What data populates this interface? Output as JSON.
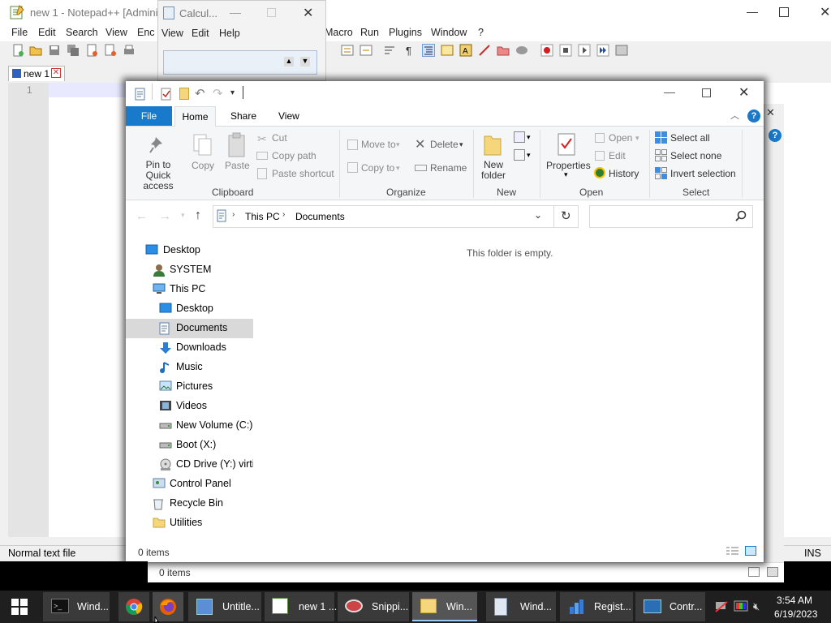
{
  "notepad": {
    "title": "new 1 - Notepad++ [Adminis",
    "menu": [
      "File",
      "Edit",
      "Search",
      "View",
      "Enc",
      "Macro",
      "Run",
      "Plugins",
      "Window",
      "?"
    ],
    "tab_label": "new 1",
    "line_number": "1",
    "status_left": "Normal text file",
    "status_right": "INS"
  },
  "calculator": {
    "title": "Calcul...",
    "menu": [
      "View",
      "Edit",
      "Help"
    ]
  },
  "explorer": {
    "tabs": [
      "File",
      "Home",
      "Share",
      "View"
    ],
    "ribbon": {
      "clipboard": {
        "pin": "Pin to Quick access",
        "copy": "Copy",
        "paste": "Paste",
        "cut": "Cut",
        "copy_path": "Copy path",
        "paste_shortcut": "Paste shortcut",
        "group": "Clipboard"
      },
      "organize": {
        "move_to": "Move to",
        "copy_to": "Copy to",
        "delete": "Delete",
        "rename": "Rename",
        "group": "Organize"
      },
      "new": {
        "new_folder": "New folder",
        "group": "New"
      },
      "open": {
        "properties": "Properties",
        "open": "Open",
        "edit": "Edit",
        "history": "History",
        "group": "Open"
      },
      "select": {
        "select_all": "Select all",
        "select_none": "Select none",
        "invert": "Invert selection",
        "group": "Select"
      }
    },
    "breadcrumb": [
      "This PC",
      "Documents"
    ],
    "tree": [
      "Desktop",
      "SYSTEM",
      "This PC",
      "Desktop",
      "Documents",
      "Downloads",
      "Music",
      "Pictures",
      "Videos",
      "New Volume (C:)",
      "Boot (X:)",
      "CD Drive (Y:) virtic",
      "Control Panel",
      "Recycle Bin",
      "Utilities"
    ],
    "empty_message": "This folder is empty.",
    "status": "0 items",
    "behind_status": "0 items"
  },
  "taskbar": {
    "items": [
      "Wind...",
      "",
      "",
      "Untitle...",
      "new 1 ...",
      "Snippi...",
      "Win...",
      "Wind...",
      "Regist...",
      "Contr..."
    ],
    "time": "3:54 AM",
    "date": "6/19/2023"
  },
  "colors": {
    "accent": "#1979ca",
    "selection": "#cce8ff",
    "taskbar": "#1f1f1f"
  }
}
